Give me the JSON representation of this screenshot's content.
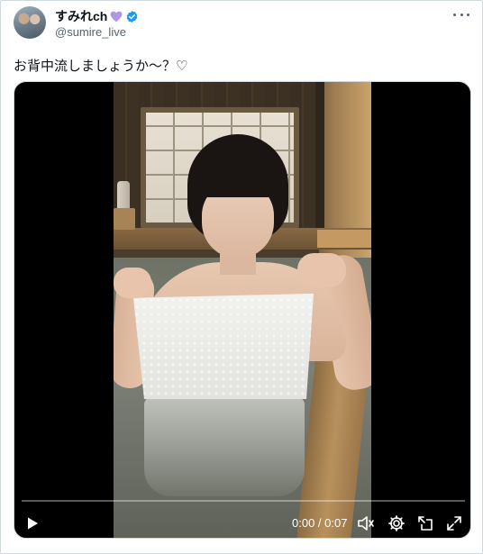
{
  "post": {
    "display_name": "すみれch",
    "handle": "@sumire_live",
    "text": "お背中流しましょうか～？♡",
    "name_emoji": "purple-heart-icon",
    "badge": "verified-badge-icon"
  },
  "media": {
    "type": "video",
    "time_display": "0:00 / 0:07",
    "progress_fraction": 0.0,
    "icons": [
      "play-icon",
      "volume-icon",
      "settings-icon",
      "pip-icon",
      "fullscreen-icon"
    ]
  },
  "colors": {
    "text": "#0f1419",
    "secondary_text": "#536471",
    "verified": "#1d9bf0",
    "heart": "#b196e8",
    "media_bg": "#000000"
  }
}
